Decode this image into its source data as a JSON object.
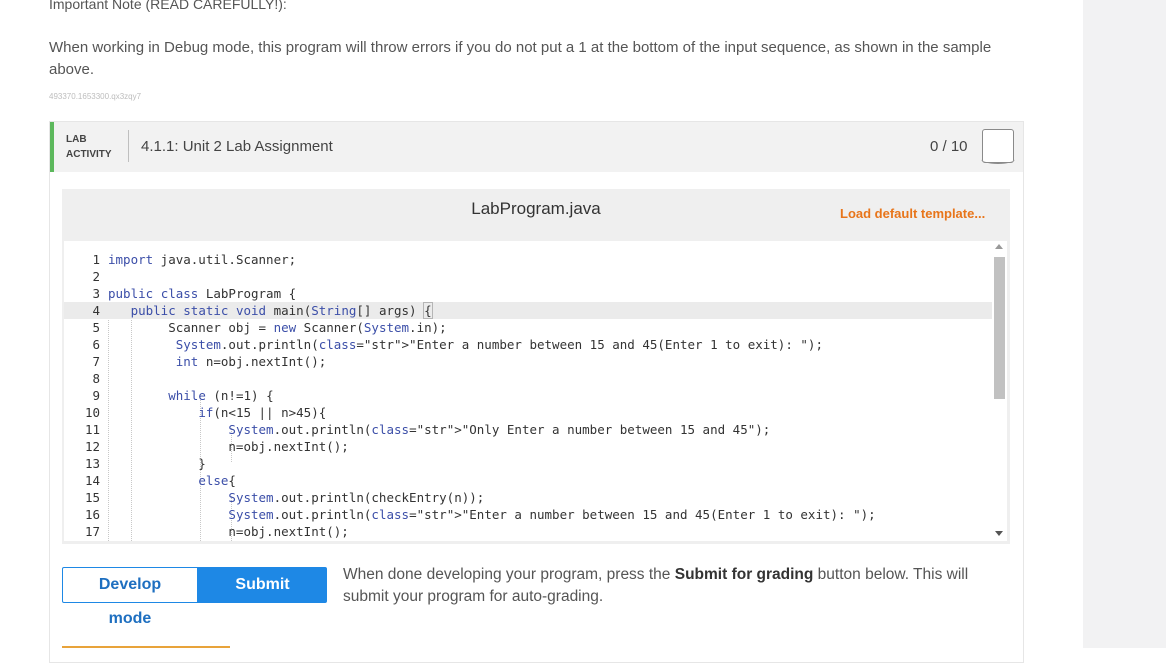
{
  "note": {
    "heading": "Important Note (READ CAREFULLY!):",
    "body": "When working in Debug mode, this program will throw errors if you do not put a 1 at the bottom of the input sequence, as shown in the sample above.",
    "id_text": "493370.1653300.qx3zqy7"
  },
  "lab": {
    "tag_line1": "LAB",
    "tag_line2": "ACTIVITY",
    "title": "4.1.1: Unit 2 Lab Assignment",
    "score": "0 / 10",
    "accent_color": "#5cb85c"
  },
  "editor": {
    "file_name": "LabProgram.java",
    "load_template_label": "Load default template...",
    "load_template_color": "#e8751a",
    "lines": [
      {
        "n": "1",
        "text": "import java.util.Scanner;"
      },
      {
        "n": "2",
        "text": ""
      },
      {
        "n": "3",
        "text": "public class LabProgram {"
      },
      {
        "n": "4",
        "text": "   public static void main(String[] args) {"
      },
      {
        "n": "5",
        "text": "        Scanner obj = new Scanner(System.in);"
      },
      {
        "n": "6",
        "text": "         System.out.println(\"Enter a number between 15 and 45(Enter 1 to exit): \");"
      },
      {
        "n": "7",
        "text": "         int n=obj.nextInt();"
      },
      {
        "n": "8",
        "text": ""
      },
      {
        "n": "9",
        "text": "        while (n!=1) {"
      },
      {
        "n": "10",
        "text": "            if(n<15 || n>45){"
      },
      {
        "n": "11",
        "text": "                System.out.println(\"Only Enter a number between 15 and 45\");"
      },
      {
        "n": "12",
        "text": "                n=obj.nextInt();"
      },
      {
        "n": "13",
        "text": "            }"
      },
      {
        "n": "14",
        "text": "            else{"
      },
      {
        "n": "15",
        "text": "                System.out.println(checkEntry(n));"
      },
      {
        "n": "16",
        "text": "                System.out.println(\"Enter a number between 15 and 45(Enter 1 to exit): \");"
      },
      {
        "n": "17",
        "text": "                n=obj.nextInt();"
      }
    ],
    "active_line": "4"
  },
  "modes": {
    "develop_label": "Develop mode",
    "submit_label": "Submit mode",
    "selected": "Submit mode",
    "accent_color": "#1e88e5"
  },
  "submit_note": {
    "before": "When done developing your program, press the ",
    "bold": "Submit for grading",
    "after": " button below. This will submit your program for auto-grading."
  }
}
